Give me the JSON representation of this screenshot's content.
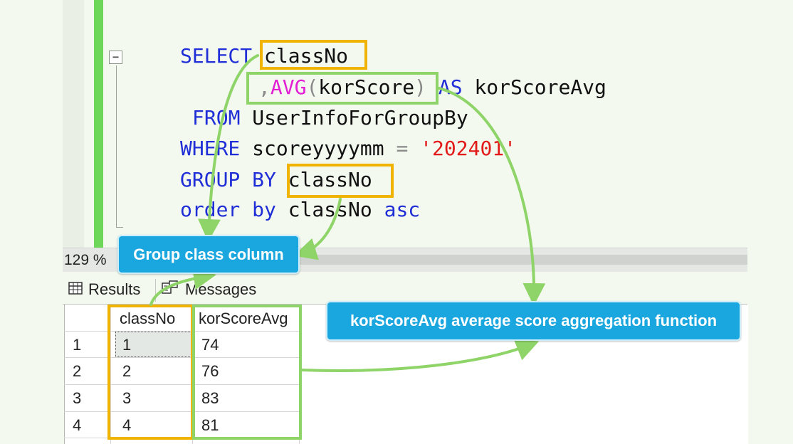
{
  "editor": {
    "fold_glyph": "−",
    "line1": {
      "kw": "SELECT",
      "col": "classNo"
    },
    "line2": {
      "comma": ",",
      "fn": "AVG",
      "open": "(",
      "arg": "korScore",
      "close": ")",
      "as": "AS",
      "alias": "korScoreAvg"
    },
    "line3": {
      "kw": "FROM",
      "table": "UserInfoForGroupBy"
    },
    "line4": {
      "kw": "WHERE",
      "col": "scoreyyyymm",
      "eq": "=",
      "str": "'202401'"
    },
    "line5": {
      "kw": "GROUP BY",
      "col": "classNo"
    },
    "line6": {
      "kw1": "order by",
      "col": "classNo",
      "kw2": "asc"
    }
  },
  "zoom": {
    "label": "129 %"
  },
  "tabs": {
    "results": {
      "label": "Results",
      "icon": "grid-icon"
    },
    "messages": {
      "label": "Messages",
      "icon": "messages-icon"
    }
  },
  "grid": {
    "columns": [
      "classNo",
      "korScoreAvg"
    ],
    "rows": [
      {
        "num": "1",
        "classNo": "1",
        "korScoreAvg": "74"
      },
      {
        "num": "2",
        "classNo": "2",
        "korScoreAvg": "76"
      },
      {
        "num": "3",
        "classNo": "3",
        "korScoreAvg": "83"
      },
      {
        "num": "4",
        "classNo": "4",
        "korScoreAvg": "81"
      }
    ]
  },
  "callouts": {
    "group": "Group class column",
    "avg": "korScoreAvg average score aggregation function"
  },
  "colors": {
    "keyword": "#1f2ed6",
    "function": "#e21fd5",
    "string": "#e21a1a",
    "highlight_yellow": "#f0b400",
    "highlight_green": "#8fd468",
    "callout_blue": "#1aa6de"
  }
}
